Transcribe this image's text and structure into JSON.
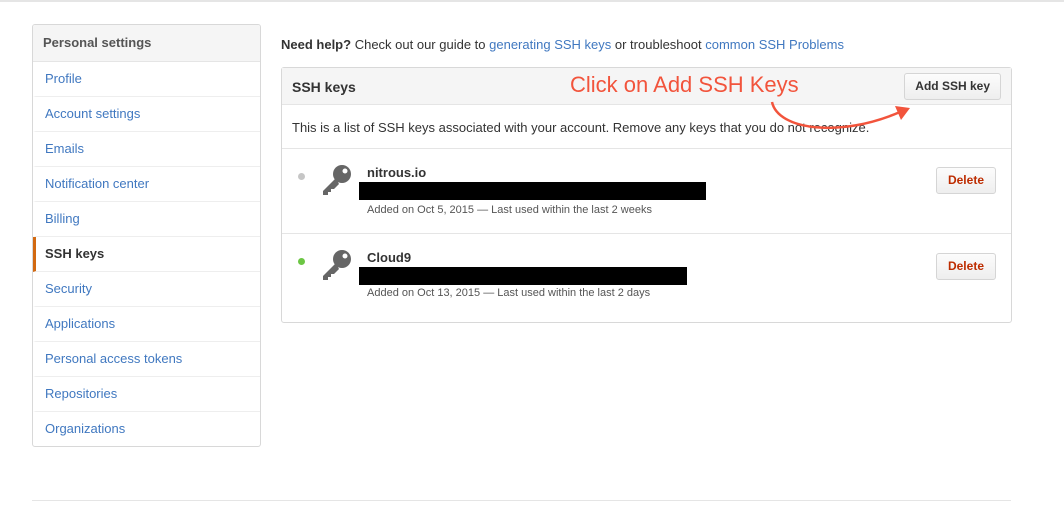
{
  "sidebar": {
    "header": "Personal settings",
    "items": [
      {
        "label": "Profile",
        "active": false
      },
      {
        "label": "Account settings",
        "active": false
      },
      {
        "label": "Emails",
        "active": false
      },
      {
        "label": "Notification center",
        "active": false
      },
      {
        "label": "Billing",
        "active": false
      },
      {
        "label": "SSH keys",
        "active": true
      },
      {
        "label": "Security",
        "active": false
      },
      {
        "label": "Applications",
        "active": false
      },
      {
        "label": "Personal access tokens",
        "active": false
      },
      {
        "label": "Repositories",
        "active": false
      },
      {
        "label": "Organizations",
        "active": false
      }
    ]
  },
  "help": {
    "prefix": "Need help?",
    "text1": "Check out our guide to",
    "link1": "generating SSH keys",
    "text2": "or troubleshoot",
    "link2": "common SSH Problems"
  },
  "panel": {
    "title": "SSH keys",
    "add_button": "Add SSH key",
    "description": "This is a list of SSH keys associated with your account. Remove any keys that you do not recognize."
  },
  "keys": [
    {
      "name": "nitrous.io",
      "meta": "Added on Oct 5, 2015 — Last used within the last 2 weeks",
      "status_color": "#c6c6c6",
      "delete_label": "Delete"
    },
    {
      "name": "Cloud9",
      "meta": "Added on Oct 13, 2015 — Last used within the last 2 days",
      "status_color": "#6cc644",
      "delete_label": "Delete"
    }
  ],
  "annotation": {
    "text": "Click on Add SSH Keys",
    "color": "#f2543c"
  },
  "colors": {
    "link": "#4078c0",
    "active_border": "#d26911",
    "danger": "#bd2c00"
  }
}
